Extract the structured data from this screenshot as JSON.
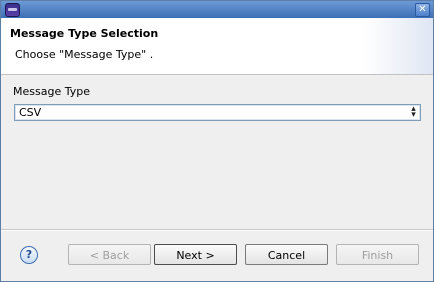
{
  "window": {
    "title": "",
    "close_symbol": "✕"
  },
  "header": {
    "title": "Message Type Selection",
    "description": "Choose \"Message Type\" ."
  },
  "form": {
    "message_type_label": "Message Type",
    "message_type_value": "CSV",
    "arrow_symbol": "⌃⌄"
  },
  "footer": {
    "help_symbol": "?",
    "back_label": "< Back",
    "next_label": "Next >",
    "cancel_label": "Cancel",
    "finish_label": "Finish"
  },
  "icons": [
    "app-icon",
    "close-icon",
    "help-icon",
    "select-arrow-icon"
  ]
}
